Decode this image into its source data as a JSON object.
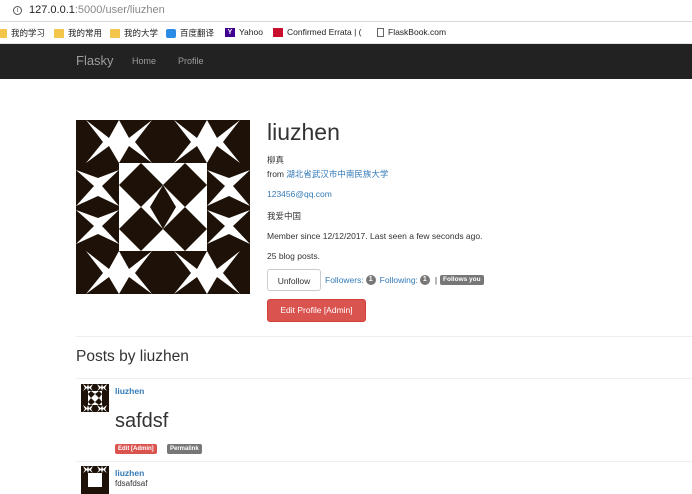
{
  "browser": {
    "url_host": "127.0.0.1",
    "url_path": ":5000/user/liuzhen",
    "bookmarks": [
      {
        "label": "我的学习",
        "icon": "folder-icon"
      },
      {
        "label": "我的常用",
        "icon": "folder-icon"
      },
      {
        "label": "我的大学",
        "icon": "folder-icon"
      },
      {
        "label": "百度翻译",
        "icon": "baidu-translate-icon"
      },
      {
        "label": "Yahoo",
        "icon": "yahoo-icon"
      },
      {
        "label": "Confirmed Errata | (",
        "icon": "oreilly-icon"
      },
      {
        "label": "FlaskBook.com",
        "icon": "page-icon"
      }
    ]
  },
  "navbar": {
    "brand": "Flasky",
    "links": [
      "Home",
      "Profile"
    ]
  },
  "profile": {
    "username": "liuzhen",
    "name": "柳真",
    "from_prefix": "from",
    "location": "湖北省武汉市中南民族大学",
    "email": "123456@qq.com",
    "about": "我爱中国",
    "member_since": "Member since 12/12/2017. Last seen a few seconds ago.",
    "blog_posts": "25 blog posts.",
    "unfollow_label": "Unfollow",
    "followers_label": "Followers:",
    "followers_count": "1",
    "following_label": "Following:",
    "following_count": "1",
    "separator": "|",
    "follows_you": "Follows you",
    "edit_admin": "Edit Profile [Admin]"
  },
  "posts_title": "Posts by liuzhen",
  "posts": [
    {
      "author": "liuzhen",
      "body": "safdsf",
      "edit_label": "Edit [Admin]",
      "permalink_label": "Permalink"
    },
    {
      "author": "liuzhen",
      "body": "fdsafdsaf"
    }
  ],
  "colors": {
    "navbar": "#222222",
    "link": "#337ab7",
    "danger": "#d9534f",
    "gray_label": "#777777"
  }
}
